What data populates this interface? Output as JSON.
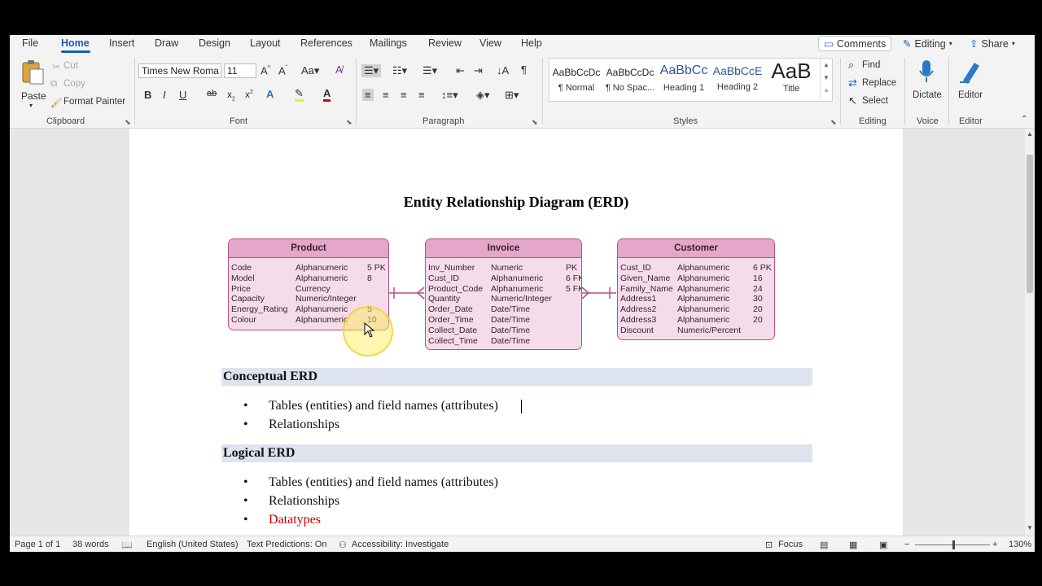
{
  "ribbon_tabs": [
    "File",
    "Home",
    "Insert",
    "Draw",
    "Design",
    "Layout",
    "References",
    "Mailings",
    "Review",
    "View",
    "Help"
  ],
  "top_right": {
    "comments": "Comments",
    "editing": "Editing",
    "share": "Share"
  },
  "clipboard": {
    "paste": "Paste",
    "cut": "Cut",
    "copy": "Copy",
    "format_painter": "Format Painter",
    "label": "Clipboard"
  },
  "font": {
    "name": "Times New Roma",
    "size": "11",
    "label": "Font"
  },
  "paragraph": {
    "label": "Paragraph"
  },
  "styles": {
    "label": "Styles",
    "items": [
      {
        "preview": "AaBbCcDc",
        "name": "¶ Normal"
      },
      {
        "preview": "AaBbCcDc",
        "name": "¶ No Spac..."
      },
      {
        "preview": "AaBbCc",
        "name": "Heading 1"
      },
      {
        "preview": "AaBbCcE",
        "name": "Heading 2"
      },
      {
        "preview": "AaB",
        "name": "Title"
      }
    ]
  },
  "editing_group": {
    "find": "Find",
    "replace": "Replace",
    "select": "Select",
    "label": "Editing"
  },
  "voice": {
    "dictate": "Dictate",
    "label": "Voice"
  },
  "editor_group": {
    "editor": "Editor",
    "label": "Editor"
  },
  "document": {
    "title": "Entity Relationship Diagram (ERD)",
    "entities": {
      "product": {
        "name": "Product",
        "rows": [
          [
            "Code",
            "Alphanumeric",
            "5 PK"
          ],
          [
            "Model",
            "Alphanumeric",
            "8"
          ],
          [
            "Price",
            "Currency",
            ""
          ],
          [
            "Capacity",
            "Numeric/Integer",
            ""
          ],
          [
            "Energy_Rating",
            "Alphanumeric",
            "5"
          ],
          [
            "Colour",
            "Alphanumeric",
            "10"
          ]
        ]
      },
      "invoice": {
        "name": "Invoice",
        "rows": [
          [
            "Inv_Number",
            "Numeric",
            "PK"
          ],
          [
            "Cust_ID",
            "Alphanumeric",
            "6 FK"
          ],
          [
            "Product_Code",
            "Alphanumeric",
            "5 FK"
          ],
          [
            "Quantity",
            "Numeric/Integer",
            ""
          ],
          [
            "Order_Date",
            "Date/Time",
            ""
          ],
          [
            "Order_Time",
            "Date/Time",
            ""
          ],
          [
            "Collect_Date",
            "Date/Time",
            ""
          ],
          [
            "Collect_Time",
            "Date/Time",
            ""
          ]
        ]
      },
      "customer": {
        "name": "Customer",
        "rows": [
          [
            "Cust_ID",
            "Alphanumeric",
            "6 PK"
          ],
          [
            "Given_Name",
            "Alphanumeric",
            "16"
          ],
          [
            "Family_Name",
            "Alphanumeric",
            "24"
          ],
          [
            "Address1",
            "Alphanumeric",
            "30"
          ],
          [
            "Address2",
            "Alphanumeric",
            "20"
          ],
          [
            "Address3",
            "Alphanumeric",
            "20"
          ],
          [
            "Discount",
            "Numeric/Percent",
            ""
          ]
        ]
      }
    },
    "sections": [
      {
        "heading": "Conceptual ERD",
        "bullets": [
          "Tables (entities) and field names (attributes)",
          "Relationships"
        ]
      },
      {
        "heading": "Logical ERD",
        "bullets": [
          "Tables (entities) and field names (attributes)",
          "Relationships",
          "Datatypes"
        ]
      }
    ],
    "highlight_color": "#c00000"
  },
  "status": {
    "page": "Page 1 of 1",
    "words": "38 words",
    "language": "English (United States)",
    "predictions": "Text Predictions: On",
    "accessibility": "Accessibility: Investigate",
    "focus": "Focus",
    "zoom": "130%"
  }
}
